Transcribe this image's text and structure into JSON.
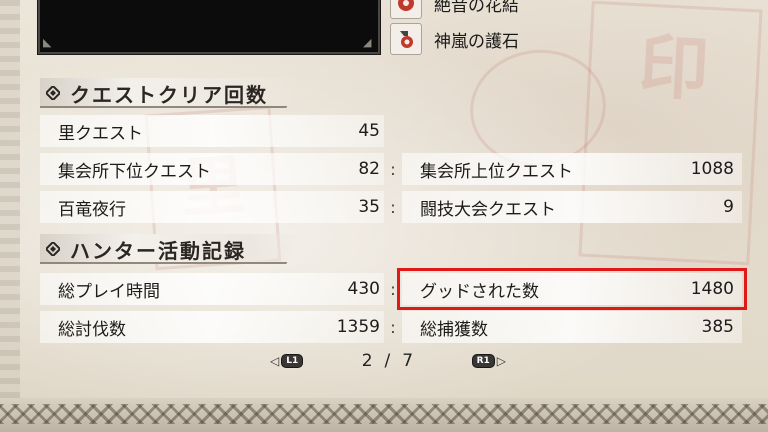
{
  "equipment": {
    "items": [
      {
        "label": "絶音の花結",
        "icon": "flower-knot-icon"
      },
      {
        "label": "神嵐の護石",
        "icon": "charm-talisman-icon"
      }
    ]
  },
  "quest_clears": {
    "title": "クエストクリア回数",
    "rows": [
      {
        "left_label": "里クエスト",
        "left_value": "45",
        "right_label": "",
        "right_value": ""
      },
      {
        "left_label": "集会所下位クエスト",
        "left_value": "82",
        "right_label": "集会所上位クエスト",
        "right_value": "1088"
      },
      {
        "left_label": "百竜夜行",
        "left_value": "35",
        "right_label": "闘技大会クエスト",
        "right_value": "9"
      }
    ]
  },
  "hunter_records": {
    "title": "ハンター活動記録",
    "rows": [
      {
        "left_label": "総プレイ時間",
        "left_value": "430",
        "right_label": "グッドされた数",
        "right_value": "1480",
        "right_highlighted": true
      },
      {
        "left_label": "総討伐数",
        "left_value": "1359",
        "right_label": "総捕獲数",
        "right_value": "385"
      }
    ]
  },
  "pager": {
    "prev_button": "L1",
    "next_button": "R1",
    "current": "2",
    "separator": "/",
    "total": "7"
  },
  "colors": {
    "highlight": "#e01818",
    "item_icon_red": "#c0392b"
  }
}
